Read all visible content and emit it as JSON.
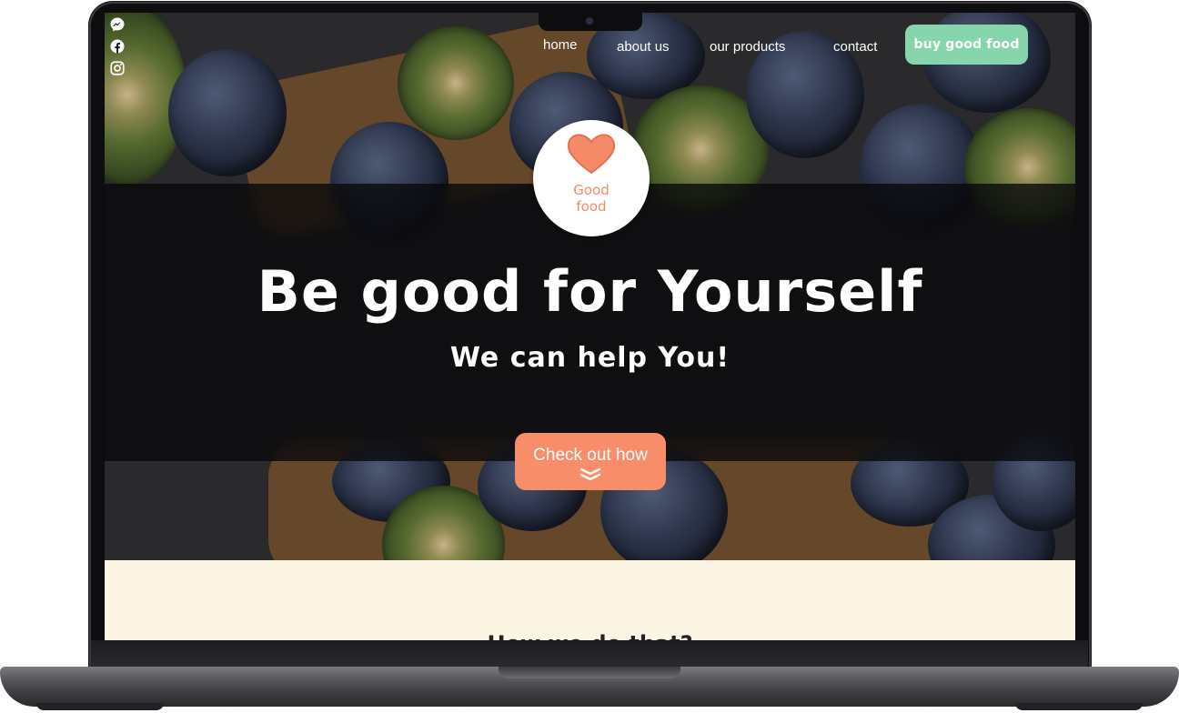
{
  "social": {
    "icons": [
      "messenger-icon",
      "facebook-icon",
      "instagram-icon"
    ]
  },
  "nav": {
    "home": "home",
    "about": "about us",
    "products": "our products",
    "contact": "contact",
    "buy": "buy good food"
  },
  "logo": {
    "line1": "Good",
    "line2": "food"
  },
  "hero": {
    "title": "Be good for Yourself",
    "subtitle": "We can help You!",
    "cta": "Check out how"
  },
  "lower": {
    "title": "How we do that?"
  },
  "colors": {
    "accent_green": "#86d6ad",
    "accent_orange": "#f78d69",
    "cream": "#fdf5e4"
  }
}
